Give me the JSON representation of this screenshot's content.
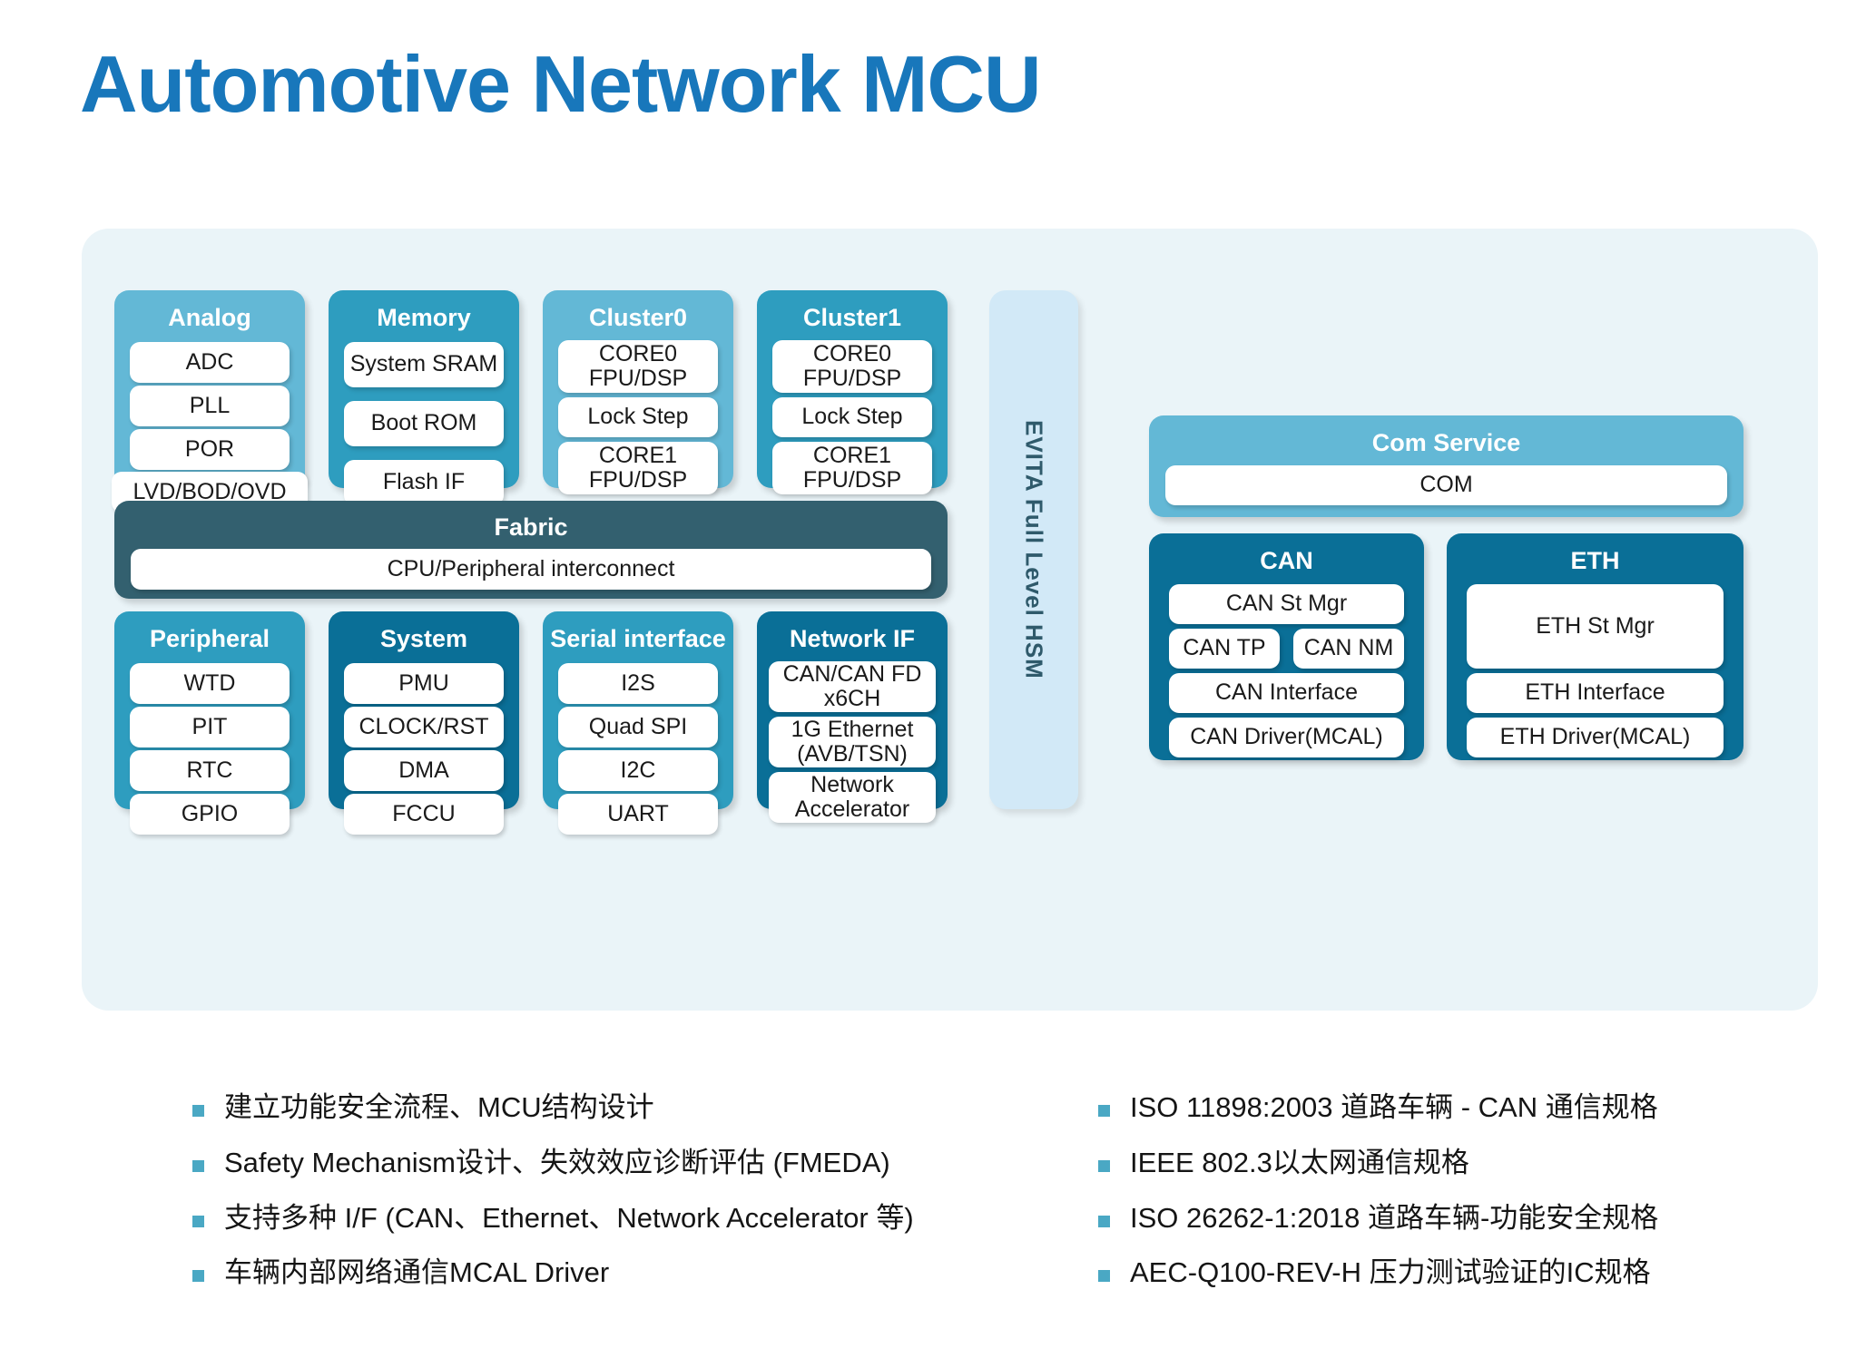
{
  "title": "Automotive Network MCU",
  "colors": {
    "title": "#1877bb",
    "canvas_bg": "#eaf4f8",
    "light_blue": "#63b8d6",
    "mid_teal": "#2e9dbf",
    "deep_blue": "#0a6f97",
    "dark_slate": "#33606f",
    "pale_blue": "#d2e9f7",
    "bullet_mark": "#4aa8c4"
  },
  "diagram": {
    "evita": {
      "label": "EVITA Full Level HSM"
    },
    "fabric": {
      "title": "Fabric",
      "items": [
        "CPU/Peripheral interconnect"
      ]
    },
    "blocks_top": [
      {
        "title": "Analog",
        "items": [
          "ADC",
          "PLL",
          "POR",
          "LVD/BOD/OVD"
        ]
      },
      {
        "title": "Memory",
        "items": [
          "System SRAM",
          "Boot ROM",
          "Flash IF"
        ]
      },
      {
        "title": "Cluster0",
        "items": [
          "CORE0\nFPU/DSP",
          "Lock Step",
          "CORE1\nFPU/DSP"
        ]
      },
      {
        "title": "Cluster1",
        "items": [
          "CORE0\nFPU/DSP",
          "Lock Step",
          "CORE1\nFPU/DSP"
        ]
      }
    ],
    "blocks_bottom": [
      {
        "title": "Peripheral",
        "items": [
          "WTD",
          "PIT",
          "RTC",
          "GPIO"
        ]
      },
      {
        "title": "System",
        "items": [
          "PMU",
          "CLOCK/RST",
          "DMA",
          "FCCU"
        ]
      },
      {
        "title": "Serial interface",
        "items": [
          "I2S",
          "Quad SPI",
          "I2C",
          "UART"
        ]
      },
      {
        "title": "Network IF",
        "items": [
          "CAN/CAN FD\nx6CH",
          "1G Ethernet\n(AVB/TSN)",
          "Network\nAccelerator"
        ]
      }
    ],
    "com_service": {
      "title": "Com Service",
      "items": [
        "COM"
      ]
    },
    "can": {
      "title": "CAN",
      "items": [
        "CAN St Mgr",
        "CAN TP",
        "CAN NM",
        "CAN Interface",
        "CAN Driver(MCAL)"
      ]
    },
    "eth": {
      "title": "ETH",
      "items": [
        "ETH St Mgr",
        "ETH Interface",
        "ETH Driver(MCAL)"
      ]
    }
  },
  "bullets_left": [
    "建立功能安全流程、MCU结构设计",
    "Safety Mechanism设计、失效效应诊断评估 (FMEDA)",
    "支持多种 I/F (CAN、Ethernet、Network Accelerator 等)",
    "车辆内部网络通信MCAL Driver"
  ],
  "bullets_right": [
    "ISO 11898:2003 道路车辆 - CAN 通信规格",
    "IEEE 802.3以太网通信规格",
    "ISO 26262-1:2018 道路车辆-功能安全规格",
    "AEC-Q100-REV-H 压力测试验证的IC规格"
  ]
}
